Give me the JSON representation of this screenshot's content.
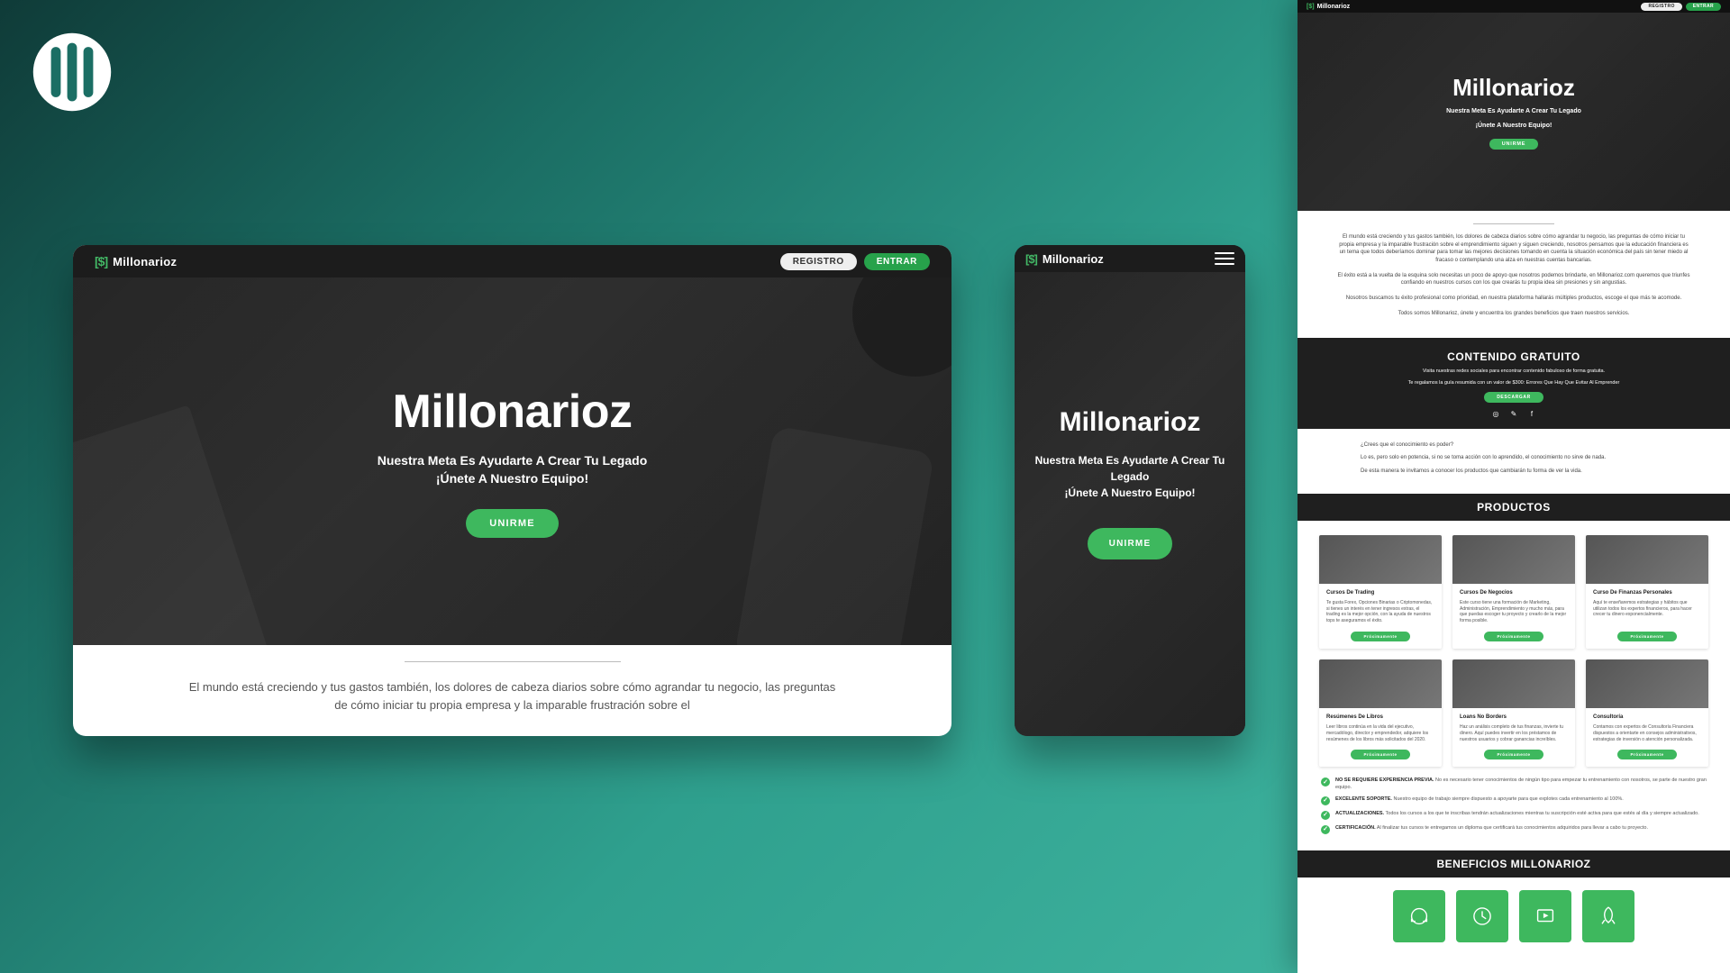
{
  "brand": {
    "mark": "[$]",
    "name": "Millonarioz"
  },
  "nav": {
    "registro": "REGISTRO",
    "entrar": "ENTRAR"
  },
  "hero": {
    "title": "Millonarioz",
    "sub1": "Nuestra Meta Es Ayudarte A Crear Tu Legado",
    "sub2": "¡Únete A Nuestro Equipo!",
    "cta": "UNIRME"
  },
  "intro": {
    "p1": "El mundo está creciendo y tus gastos también, los dolores de cabeza diarios sobre cómo agrandar tu negocio, las preguntas de cómo iniciar tu propia empresa y la imparable frustración sobre el",
    "f1": "El mundo está creciendo y tus gastos también, los dolores de cabeza diarios sobre cómo agrandar tu negocio, las preguntas de cómo iniciar tu propia empresa y la imparable frustración sobre el emprendimiento siguen y siguen creciendo, nosotros pensamos que la educación financiera es un tema que todos deberíamos dominar para tomar las mejores decisiones tomando en cuenta la situación económica del país sin tener miedo al fracaso o contemplando una alza en nuestras cuentas bancarias.",
    "f2": "El éxito está a la vuelta de la esquina solo necesitas un poco de apoyo que nosotros podemos brindarte, en Millonarioz.com queremos que triunfes confiando en nuestros cursos con los que crearás tu propia idea sin presiones y sin angustias.",
    "f3": "Nosotros buscamos tu éxito profesional como prioridad, en nuestra plataforma hallarás múltiples productos, escoge el que más te acomode.",
    "f4": "Todos somos Millonarioz, únete y encuentra los grandes beneficios que traen nuestros servicios."
  },
  "gratuito": {
    "title": "CONTENIDO GRATUITO",
    "line1": "Visita nuestras redes sociales para encontrar contenido fabuloso de forma gratuita.",
    "line2": "Te regalamos la guía resumida con un valor de $300: Errores Que Hay Que Evitar Al Emprender",
    "btn": "DESCARGAR"
  },
  "know": {
    "q": "¿Crees que el conocimiento es poder?",
    "p1": "Lo es, pero solo en potencia, si no se toma acción con lo aprendido, el conocimiento no sirve de nada.",
    "p2": "De esta manera te invitamos a conocer los productos que cambiarán tu forma de ver la vida."
  },
  "productsTitle": "PRODUCTOS",
  "products": [
    {
      "title": "Cursos De Trading",
      "desc": "Te gusta Forex, Opciones Binarias o Criptomonedas, si tienes un interés en tener ingresos extras, el trading es la mejor opción, con la ayuda de nuestros tops te aseguramos el éxito.",
      "btn": "Próximamente"
    },
    {
      "title": "Cursos De Negocios",
      "desc": "Este curso tiene una formación de Marketing, Administración, Emprendimiento y mucho más, para que puedas escoger tu proyecto y crearlo de la mejor forma posible.",
      "btn": "Próximamente"
    },
    {
      "title": "Curso De Finanzas Personales",
      "desc": "Aquí te enseñaremos estrategias y hábitos que utilizan todos los expertos financieros, para hacer crecer tu dinero exponencialmente.",
      "btn": "Próximamente"
    },
    {
      "title": "Resúmenes De Libros",
      "desc": "Leer libros continúa en la vida del ejecutivo, mercadólogo, director y emprendedor, adquiere los resúmenes de los libros más solicitados del 2020.",
      "btn": "Próximamente"
    },
    {
      "title": "Loans No Borders",
      "desc": "Haz un análisis completo de tus finanzas, invierte tu dinero. Aquí puedes invertir en los préstamos de nuestros usuarios y cobrar ganancias increíbles.",
      "btn": "Próximamente"
    },
    {
      "title": "Consultoría",
      "desc": "Contamos con expertos de Consultoría Financiera dispuestos a orientarte en consejos administrativos, estrategias de inversión o atención personalizada.",
      "btn": "Próximamente"
    }
  ],
  "features": [
    {
      "title": "NO SE REQUIERE EXPERIENCIA PREVIA.",
      "desc": "No es necesario tener conocimientos de ningún tipo para empezar tu entrenamiento con nosotros, se parte de nuestro gran equipo."
    },
    {
      "title": "EXCELENTE SOPORTE.",
      "desc": "Nuestro equipo de trabajo siempre dispuesto a apoyarte para que explotes cada entrenamiento al 100%."
    },
    {
      "title": "ACTUALIZACIONES.",
      "desc": "Todos los cursos a los que te inscribas tendrán actualizaciones mientras tu suscripción esté activa para que estés al día y siempre actualizado."
    },
    {
      "title": "CERTIFICACIÓN.",
      "desc": "Al finalizar tus cursos te entregamos un diploma que certificará tus conocimientos adquiridos para llevar a cabo tu proyecto."
    }
  ],
  "benefitsTitle": "BENEFICIOS MILLONARIOZ"
}
